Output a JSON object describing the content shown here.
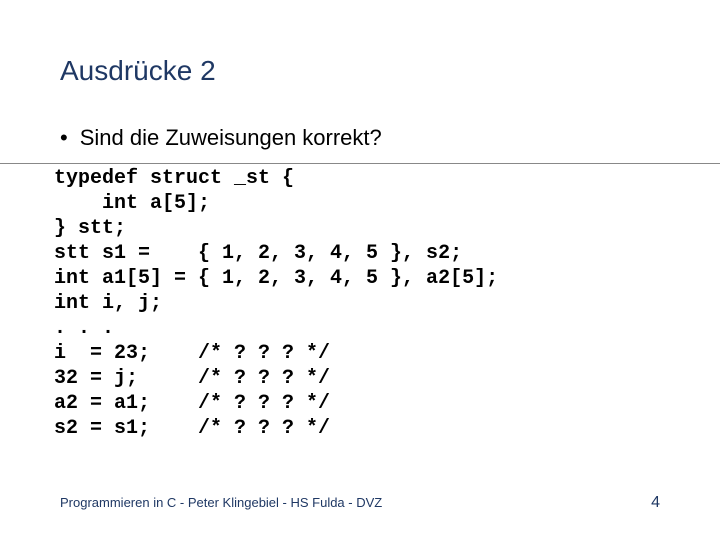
{
  "title": "Ausdrücke 2",
  "bullet_char": "•",
  "question": "Sind die Zuweisungen korrekt?",
  "code": "typedef struct _st {\n    int a[5];\n} stt;\nstt s1 =    { 1, 2, 3, 4, 5 }, s2;\nint a1[5] = { 1, 2, 3, 4, 5 }, a2[5];\nint i, j;\n. . .\ni  = 23;    /* ? ? ? */\n32 = j;     /* ? ? ? */\na2 = a1;    /* ? ? ? */\ns2 = s1;    /* ? ? ? */",
  "footer": "Programmieren in C - Peter Klingebiel - HS Fulda - DVZ",
  "page": "4"
}
